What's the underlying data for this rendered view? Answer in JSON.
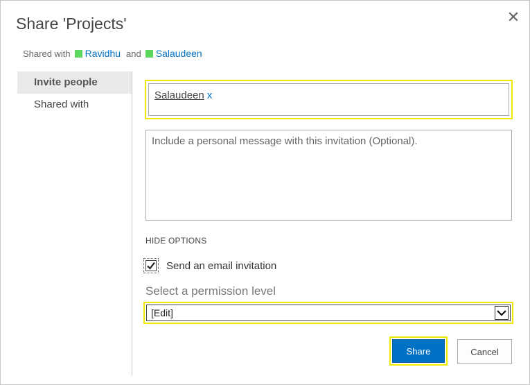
{
  "dialog": {
    "title": "Share 'Projects'",
    "close_glyph": "✕"
  },
  "shared_with": {
    "prefix": "Shared with",
    "users": [
      "Ravidhu",
      "Salaudeen"
    ],
    "conjunction": "and",
    "user_color": "#5cd65c"
  },
  "sidebar": {
    "items": [
      {
        "label": "Invite people",
        "active": true
      },
      {
        "label": "Shared with",
        "active": false
      }
    ]
  },
  "invite": {
    "people": [
      "Salaudeen"
    ],
    "remove_glyph": "x",
    "message_placeholder": "Include a personal message with this invitation (Optional)."
  },
  "options": {
    "toggle_label": "HIDE OPTIONS",
    "send_email_label": "Send an email invitation",
    "send_email_checked": true,
    "permission_label": "Select a permission level",
    "permission_value": "[Edit]"
  },
  "buttons": {
    "share": "Share",
    "cancel": "Cancel"
  },
  "colors": {
    "accent": "#0072c6",
    "highlight": "#f1e800"
  },
  "icons": {
    "close": "close-icon",
    "dropdown": "chevron-down-icon",
    "check": "checkmark-icon"
  }
}
